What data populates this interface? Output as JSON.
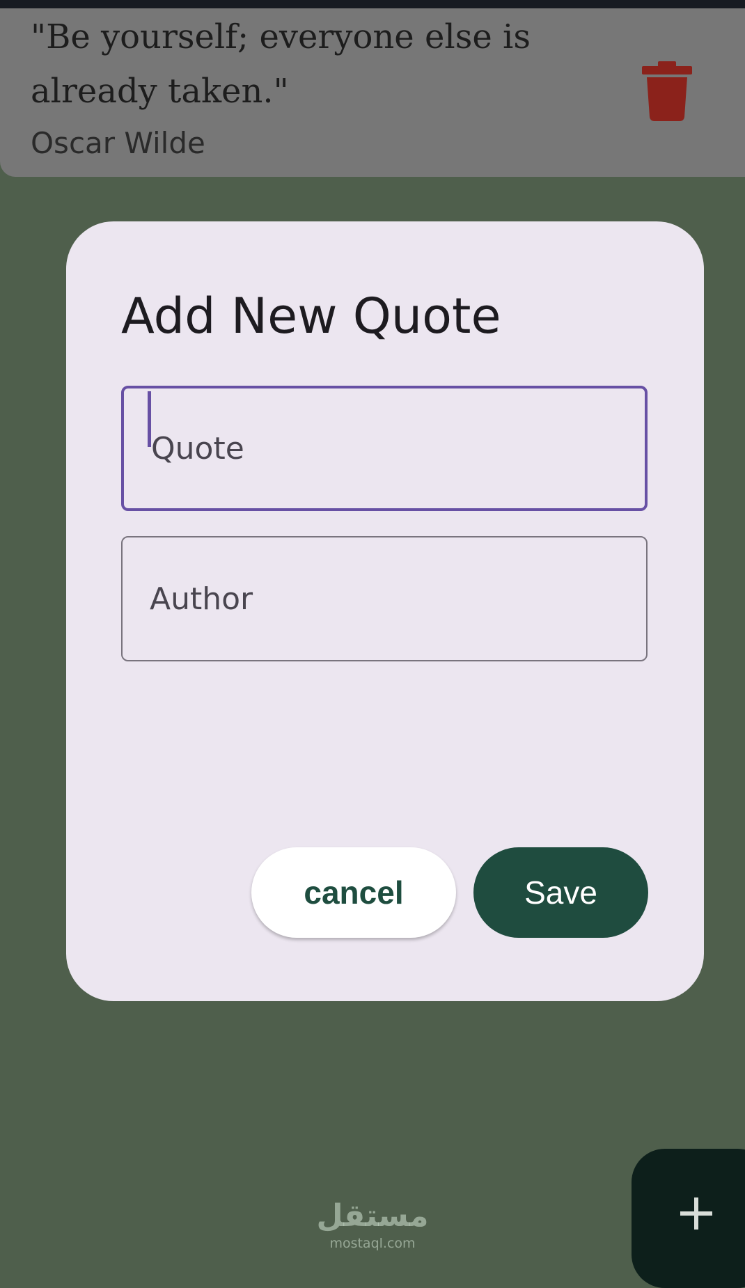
{
  "quote_card": {
    "text": "\"Be yourself; everyone else is already taken.\"",
    "author": "Oscar Wilde",
    "delete_icon": "trash-icon",
    "delete_color": "#8b221b"
  },
  "dialog": {
    "title": "Add New Quote",
    "quote_field": {
      "placeholder": "Quote",
      "value": ""
    },
    "author_field": {
      "placeholder": "Author",
      "value": ""
    },
    "cancel_label": "cancel",
    "save_label": "Save"
  },
  "fab": {
    "icon": "plus-icon"
  },
  "watermark": {
    "arabic": "مستقل",
    "latin": "mostaql.com"
  },
  "colors": {
    "background": "#4f5f4c",
    "dialog": "#ece6f0",
    "accent": "#6750a4",
    "primary": "#1f4c3f"
  }
}
